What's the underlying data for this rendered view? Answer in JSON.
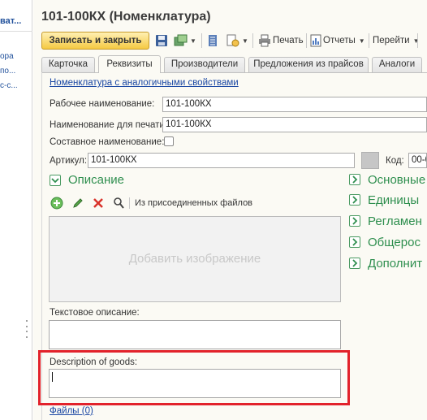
{
  "left_strip": {
    "items": [
      "ват...",
      "ора",
      "по...",
      "с-с..."
    ]
  },
  "window": {
    "title": "101-100КХ (Номенклатура)"
  },
  "toolbar": {
    "save_close_label": "Записать и закрыть",
    "print_label": "Печать",
    "reports_label": "Отчеты",
    "goto_label": "Перейти"
  },
  "tabs": [
    {
      "label": "Карточка",
      "active": false
    },
    {
      "label": "Реквизиты",
      "active": true
    },
    {
      "label": "Производители",
      "active": false
    },
    {
      "label": "Предложения из прайсов",
      "active": false
    },
    {
      "label": "Аналоги",
      "active": false
    }
  ],
  "form": {
    "similar_link": "Номенклатура с аналогичными свойствами",
    "work_name_label": "Рабочее наименование:",
    "work_name_value": "101-100КХ",
    "print_name_label": "Наименование для печати:",
    "print_name_value": "101-100КХ",
    "compound_name_label": "Составное наименование:",
    "compound_name_checked": false,
    "article_label": "Артикул:",
    "article_value": "101-100КХ",
    "code_label": "Код:",
    "code_value": "00-0"
  },
  "description": {
    "section_title": "Описание",
    "attached_files_label": "Из присоединенных файлов",
    "add_image_label": "Добавить изображение",
    "text_description_label": "Текстовое описание:",
    "text_description_value": "",
    "goods_description_label": "Description of goods:",
    "goods_description_value": "",
    "files_link": "Файлы (0)"
  },
  "right_sections": [
    "Основные",
    "Единицы",
    "Регламен",
    "Общерос",
    "Дополнит"
  ],
  "colors": {
    "accent_green": "#2f8f4f",
    "link_blue": "#1a47a3",
    "highlight_red": "#e2222b",
    "primary_button": "#f5c943"
  }
}
